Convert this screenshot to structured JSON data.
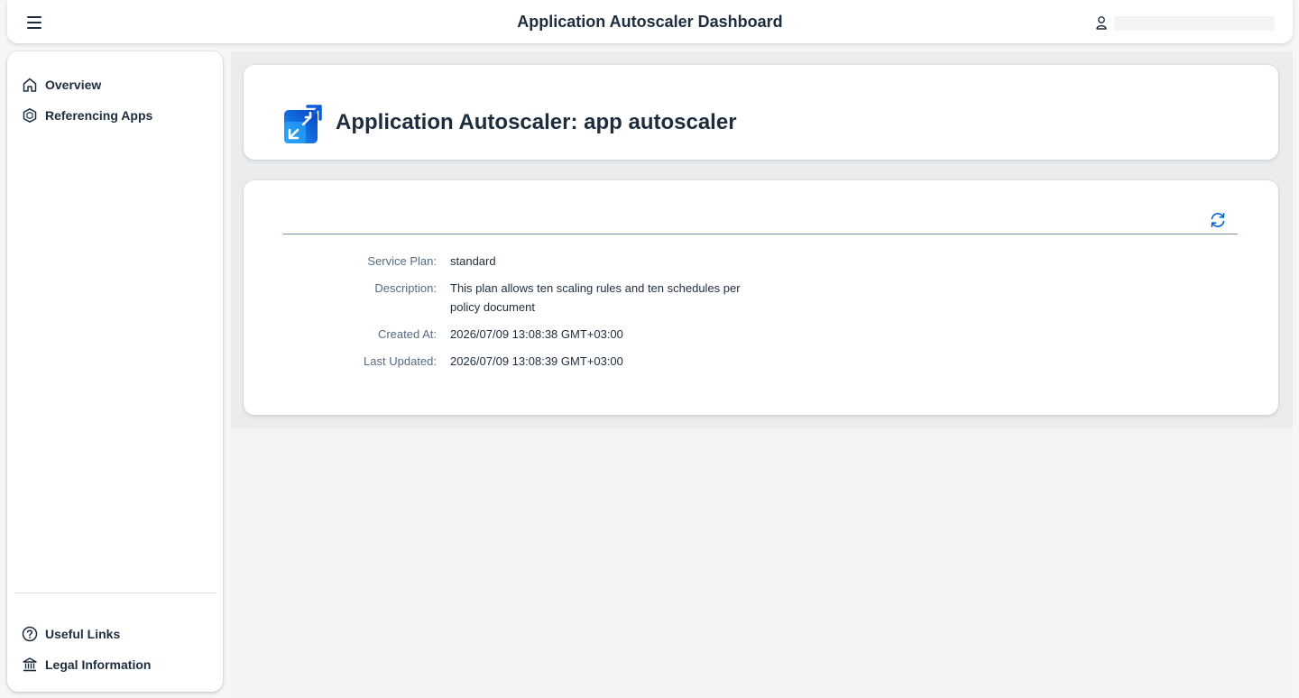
{
  "shellbar": {
    "title": "Application Autoscaler Dashboard",
    "menu_icon": "hamburger-menu-icon",
    "user_icon": "user-icon",
    "user_name": ""
  },
  "sidenav": {
    "items": [
      {
        "label": "Overview",
        "icon": "home-icon"
      },
      {
        "label": "Referencing Apps",
        "icon": "hexagon-icon"
      }
    ],
    "footer_items": [
      {
        "label": "Useful Links",
        "icon": "question-circle-icon"
      },
      {
        "label": "Legal Information",
        "icon": "building-icon"
      }
    ]
  },
  "header": {
    "title": "Application Autoscaler: app autoscaler",
    "logo_icon": "autoscaler-logo-icon"
  },
  "details": {
    "refresh_icon": "refresh-icon",
    "rows": [
      {
        "label": "Service Plan:",
        "value": "standard"
      },
      {
        "label": "Description:",
        "value": "This plan allows ten scaling rules and ten schedules per policy document"
      },
      {
        "label": "Created At:",
        "value": "2026/07/09 13:08:38 GMT+03:00"
      },
      {
        "label": "Last Updated:",
        "value": "2026/07/09 13:08:39 GMT+03:00"
      }
    ]
  },
  "colors": {
    "accent": "#0064d9",
    "text": "#1d2d3e",
    "label": "#556b82",
    "background": "#f5f6f7"
  }
}
